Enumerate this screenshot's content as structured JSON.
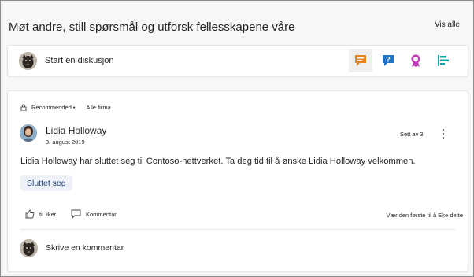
{
  "header": {
    "title": "Møt andre, still spørsmål og utforsk fellesskapene våre",
    "see_all": "Vis alle"
  },
  "composer": {
    "start_label": "Start en diskusjon",
    "post_types": [
      {
        "icon": "discussion-icon",
        "color": "#e8821e",
        "selected": true
      },
      {
        "icon": "question-icon",
        "color": "#1f73c9",
        "selected": false
      },
      {
        "icon": "praise-icon",
        "color": "#c239b3",
        "selected": false
      },
      {
        "icon": "poll-icon",
        "color": "#0ba3a3",
        "selected": false
      }
    ]
  },
  "post": {
    "recommended": "Recommended",
    "separator": "•",
    "scope": "Alle firma",
    "author": "Lidia Holloway",
    "date": "3. august 2019",
    "seen_by": "Sett av 3",
    "body": "Lidia Holloway har sluttet seg til Contoso-nettverket. Ta deg tid til å ønske Lidia Holloway velkommen.",
    "tag": "Sluttet seg",
    "like_label": "til liker",
    "comment_label": "Kommentar",
    "first_like": "Vær den første til å Eke dette",
    "reply_placeholder": "Skrive en kommentar"
  }
}
